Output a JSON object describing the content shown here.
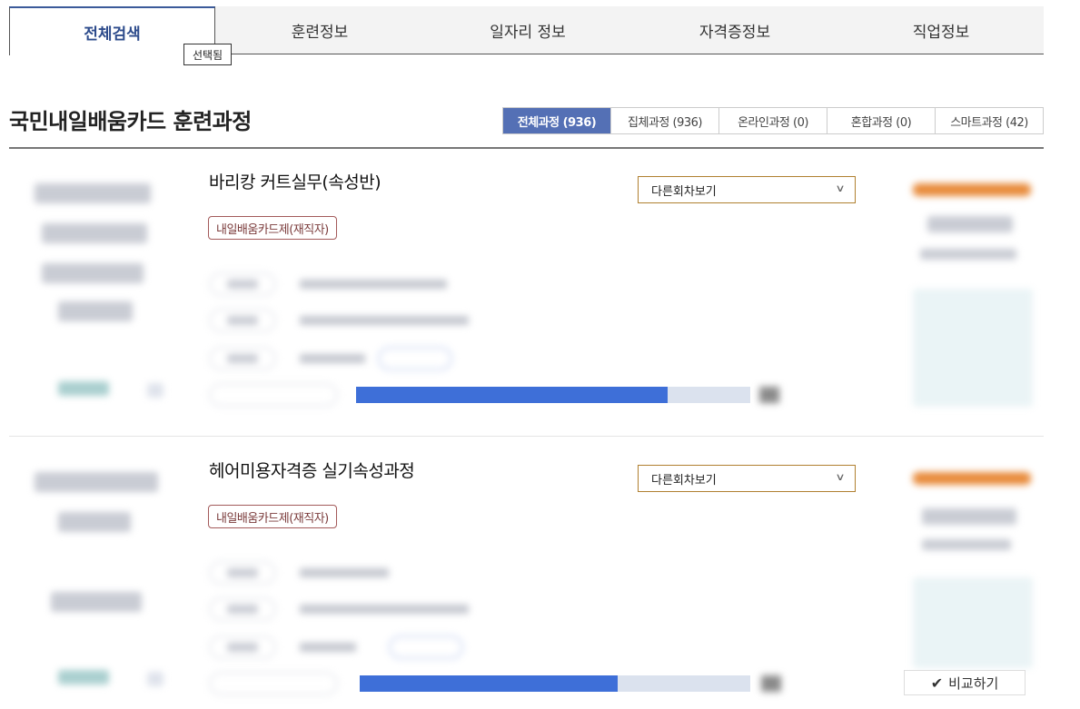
{
  "tabs": [
    {
      "label": "전체검색",
      "active": true
    },
    {
      "label": "훈련정보"
    },
    {
      "label": "일자리 정보"
    },
    {
      "label": "자격증정보"
    },
    {
      "label": "직업정보"
    }
  ],
  "tooltip": "선택됨",
  "section_title": "국민내일배움카드 훈련과정",
  "filters": [
    {
      "label": "전체과정 (936)",
      "active": true
    },
    {
      "label": "집체과정 (936)"
    },
    {
      "label": "온라인과정 (0)"
    },
    {
      "label": "혼합과정 (0)"
    },
    {
      "label": "스마트과정 (42)"
    }
  ],
  "courses": [
    {
      "title": "바리캉 커트실무(속성반)",
      "session_select": "다른회차보기",
      "badge": "내일배움카드제(재직자)",
      "progress": 0.79
    },
    {
      "title": "헤어미용자격증 실기속성과정",
      "session_select": "다른회차보기",
      "badge": "내일배움카드제(재직자)",
      "progress": 0.66
    }
  ],
  "compare_button": "비교하기",
  "icons": {
    "dropdown": "chevron-down-icon",
    "compare": "check-icon"
  },
  "colors": {
    "accent": "#5470b5",
    "progress": "#3e6fd8",
    "badge_border": "#a35a5a",
    "select_border": "#b08030"
  }
}
